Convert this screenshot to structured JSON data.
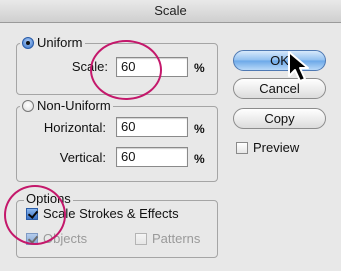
{
  "window": {
    "title": "Scale"
  },
  "uniform": {
    "label": "Uniform",
    "scale_label": "Scale:",
    "scale_value": "60",
    "scale_unit": "%"
  },
  "non_uniform": {
    "label": "Non-Uniform",
    "horizontal_label": "Horizontal:",
    "horizontal_value": "60",
    "horizontal_unit": "%",
    "vertical_label": "Vertical:",
    "vertical_value": "60",
    "vertical_unit": "%"
  },
  "options": {
    "label": "Options",
    "scale_strokes_label": "Scale Strokes & Effects",
    "objects_label": "Objects",
    "patterns_label": "Patterns"
  },
  "buttons": {
    "ok": "OK",
    "cancel": "Cancel",
    "copy": "Copy"
  },
  "preview_label": "Preview",
  "colors": {
    "annotation": "#c4186b",
    "accent": "#3b75c9"
  }
}
